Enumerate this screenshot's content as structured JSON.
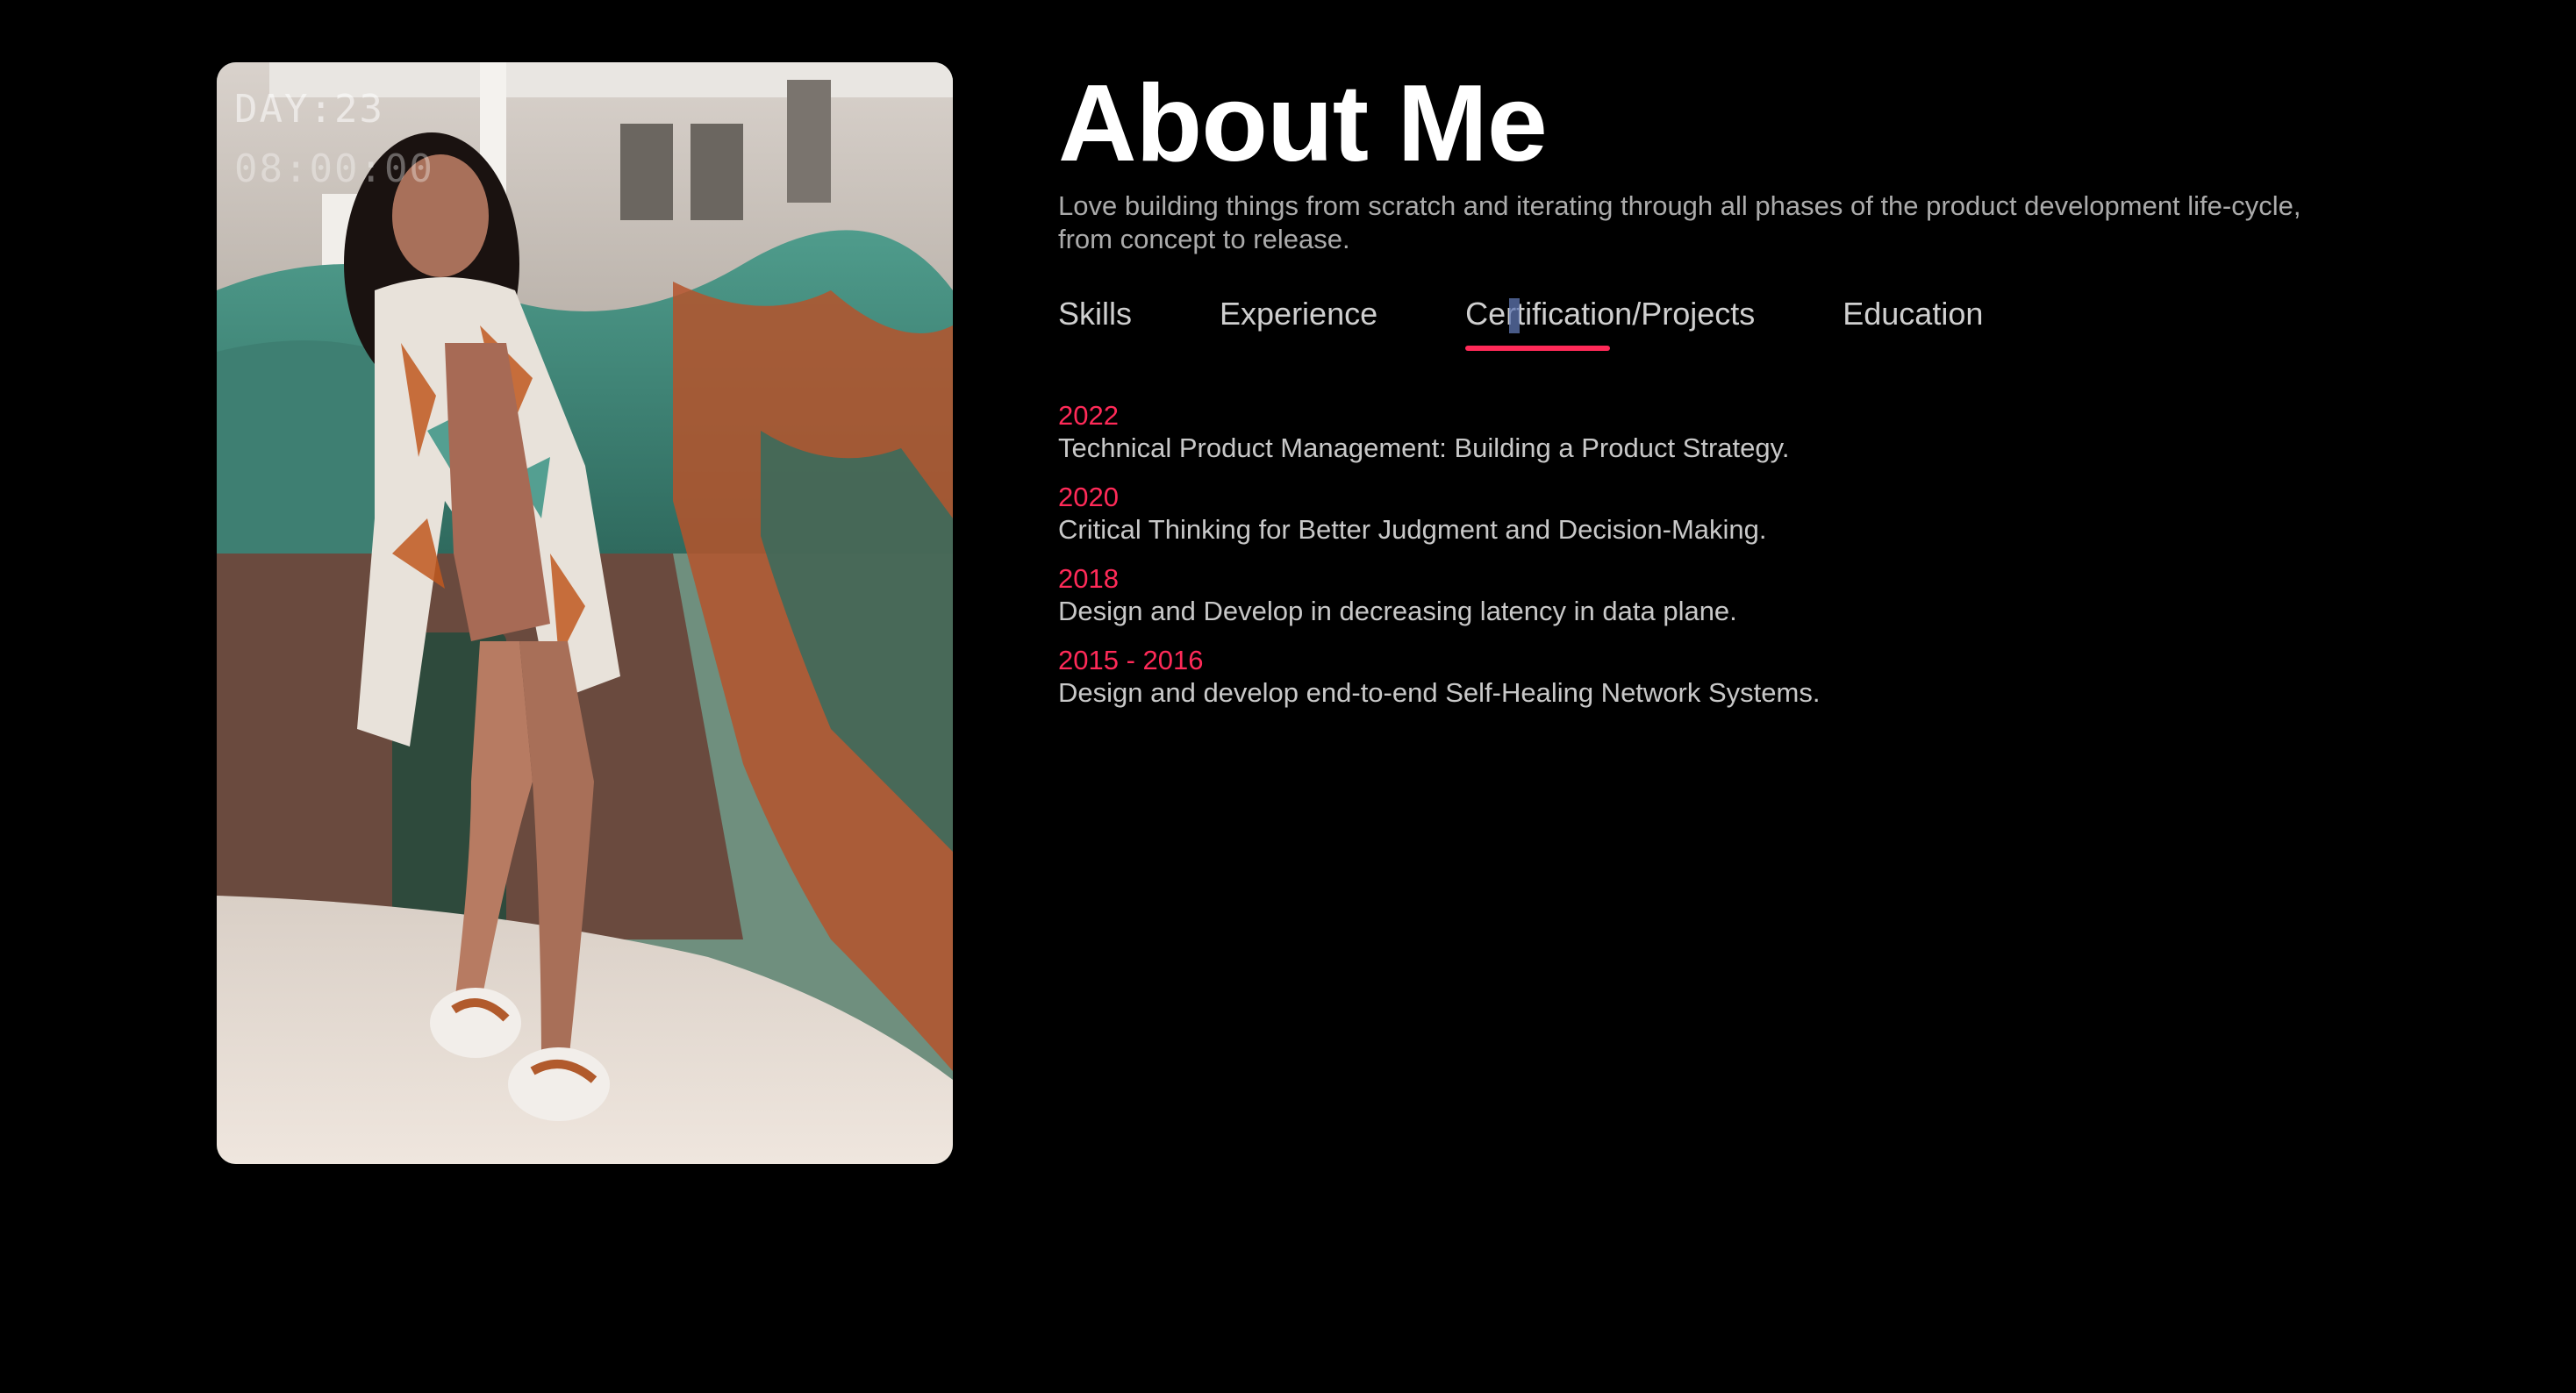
{
  "photo": {
    "stamp_day": "DAY:23",
    "stamp_time": "08:00:00"
  },
  "header": {
    "title": "About Me",
    "intro": "Love building things from scratch and iterating through all phases of the product development life-cycle, from concept to release."
  },
  "tabs": [
    {
      "label": "Skills",
      "active": false
    },
    {
      "label": "Experience",
      "active": false
    },
    {
      "label": "Certification/Projects",
      "active": true
    },
    {
      "label": "Education",
      "active": false
    }
  ],
  "entries": [
    {
      "year": "2022",
      "text": "Technical Product Management: Building a Product Strategy."
    },
    {
      "year": "2020",
      "text": "Critical Thinking for Better Judgment and Decision-Making."
    },
    {
      "year": "2018",
      "text": "Design and Develop in decreasing latency in data plane."
    },
    {
      "year": "2015 - 2016",
      "text": "Design and develop end-to-end Self-Healing Network Systems."
    }
  ],
  "colors": {
    "background": "#000000",
    "accent": "#ff2a58",
    "title": "#ffffff",
    "body_text": "#c8c8c8"
  }
}
